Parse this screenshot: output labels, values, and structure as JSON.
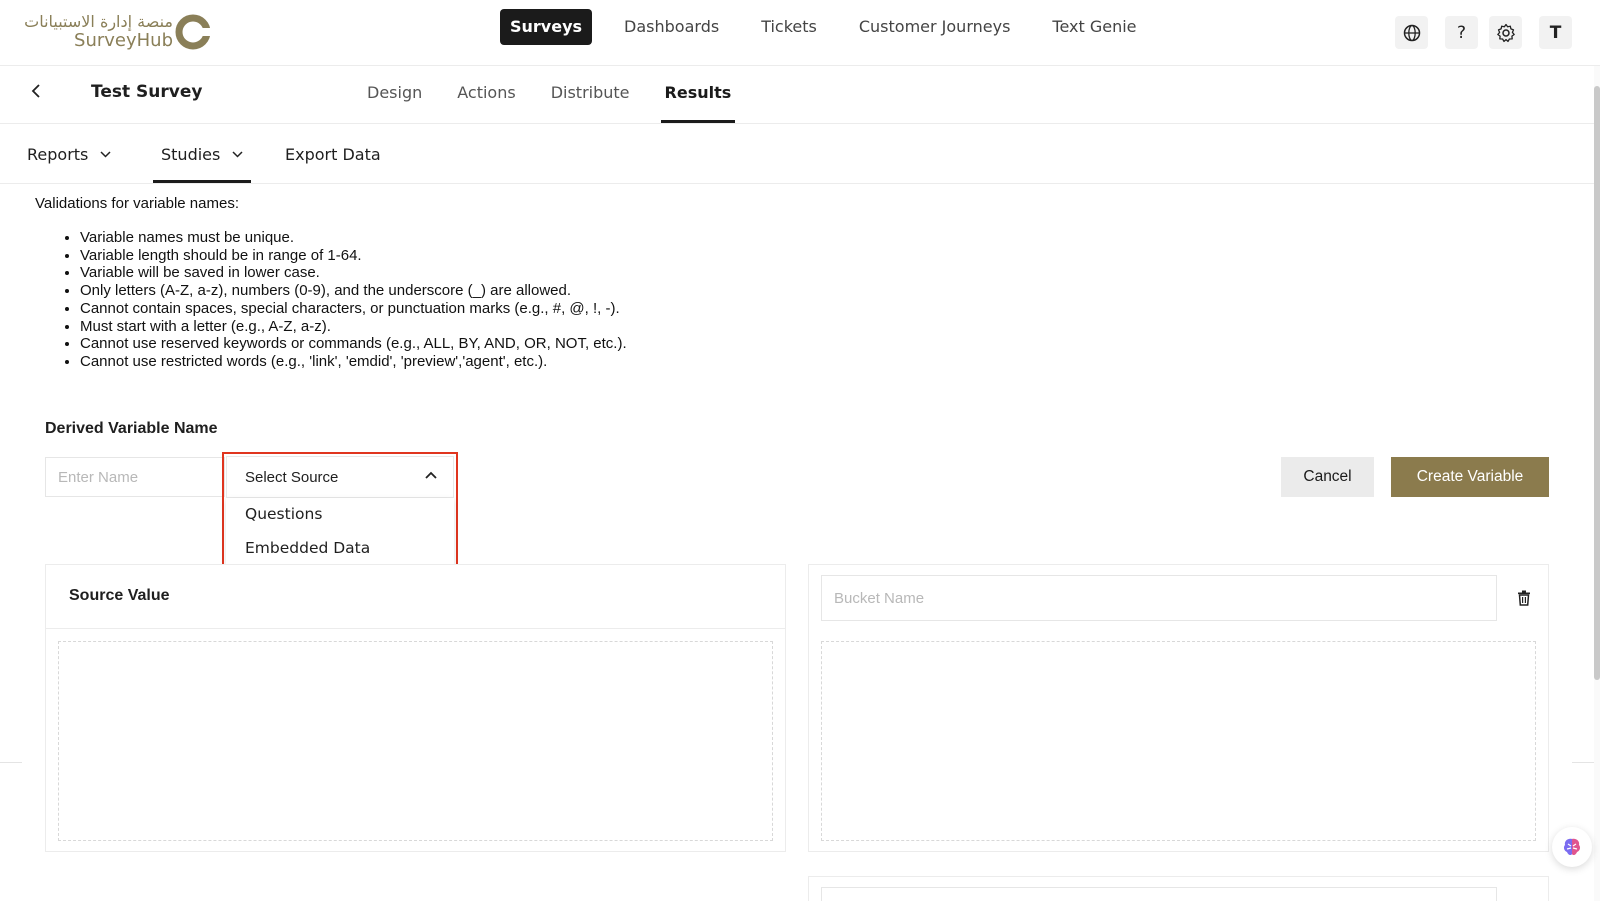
{
  "brand": {
    "arabic_name": "منصة إدارة الاستبيانات",
    "name": "SurveyHub",
    "accent_color": "#8b7b4d"
  },
  "top_nav": {
    "items": [
      {
        "label": "Surveys",
        "active": true
      },
      {
        "label": "Dashboards",
        "active": false
      },
      {
        "label": "Tickets",
        "active": false
      },
      {
        "label": "Customer Journeys",
        "active": false
      },
      {
        "label": "Text Genie",
        "active": false
      }
    ],
    "tools": {
      "globe_icon": "globe-icon",
      "help_icon": "help-icon",
      "settings_icon": "gear-icon",
      "avatar_initial": "T"
    }
  },
  "survey_header": {
    "back_icon": "chevron-left-icon",
    "title": "Test Survey",
    "tabs": [
      {
        "label": "Design",
        "active": false
      },
      {
        "label": "Actions",
        "active": false
      },
      {
        "label": "Distribute",
        "active": false
      },
      {
        "label": "Results",
        "active": true
      }
    ]
  },
  "results_nav": {
    "tabs": [
      {
        "label": "Reports",
        "has_dropdown": true,
        "active": false
      },
      {
        "label": "Studies",
        "has_dropdown": true,
        "active": true
      },
      {
        "label": "Export Data",
        "has_dropdown": false,
        "active": false
      }
    ]
  },
  "validations": {
    "title": "Validations for variable names:",
    "rules": [
      "Variable names must be unique.",
      "Variable length should be in range of 1-64.",
      "Variable will be saved in lower case.",
      "Only letters (A-Z, a-z), numbers (0-9), and the underscore (_) are allowed.",
      "Cannot contain spaces, special characters, or punctuation marks (e.g., #, @, !, -).",
      "Must start with a letter (e.g., A-Z, a-z).",
      "Cannot use reserved keywords or commands (e.g., ALL, BY, AND, OR, NOT, etc.).",
      "Cannot use restricted words (e.g., 'link', 'emdid', 'preview','agent', etc.)."
    ]
  },
  "derived_variable": {
    "label": "Derived Variable Name",
    "name_input": {
      "value": "",
      "placeholder": "Enter Name"
    },
    "source_select": {
      "value": "Select Source",
      "open": true,
      "options": [
        "Questions",
        "Embedded Data"
      ]
    },
    "cancel_label": "Cancel",
    "create_label": "Create Variable"
  },
  "source_panel": {
    "title": "Source Value"
  },
  "bucket_panel": {
    "name_input": {
      "value": "",
      "placeholder": "Bucket Name"
    },
    "delete_icon": "trash-icon"
  }
}
